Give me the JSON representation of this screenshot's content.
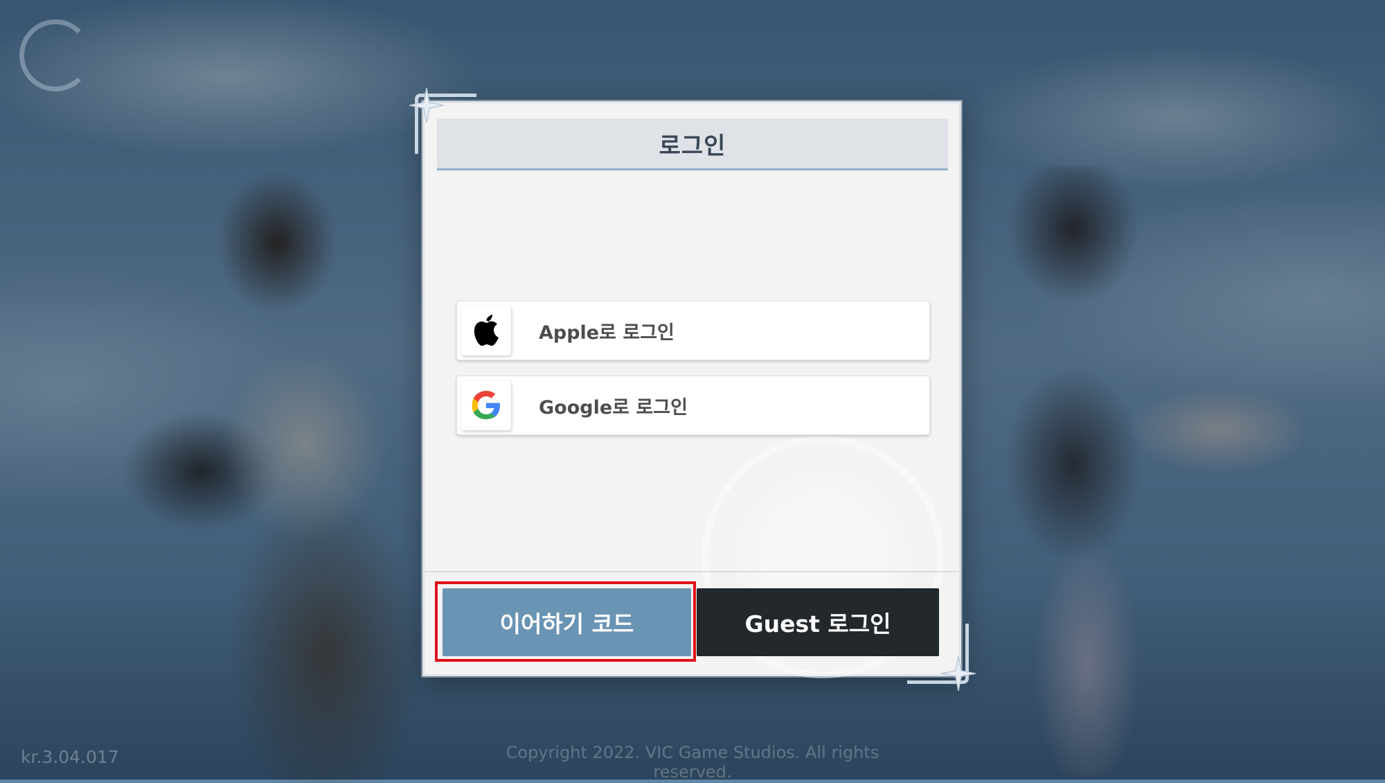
{
  "background": {
    "version_text": "kr.3.04.017",
    "copyright_text": "Copyright 2022. VIC Game Studios. All rights reserved."
  },
  "dialog": {
    "title": "로그인",
    "login_options": [
      {
        "label": "Apple로 로그인",
        "icon": "apple-icon"
      },
      {
        "label": "Google로 로그인",
        "icon": "google-icon"
      }
    ],
    "continue_code_label": "이어하기 코드",
    "guest_login_label": "Guest 로그인"
  },
  "colors": {
    "continue_button": "#6a94b4",
    "guest_button": "#23282d",
    "highlight": "#e0101a",
    "header_underline": "#8fb0cc"
  }
}
